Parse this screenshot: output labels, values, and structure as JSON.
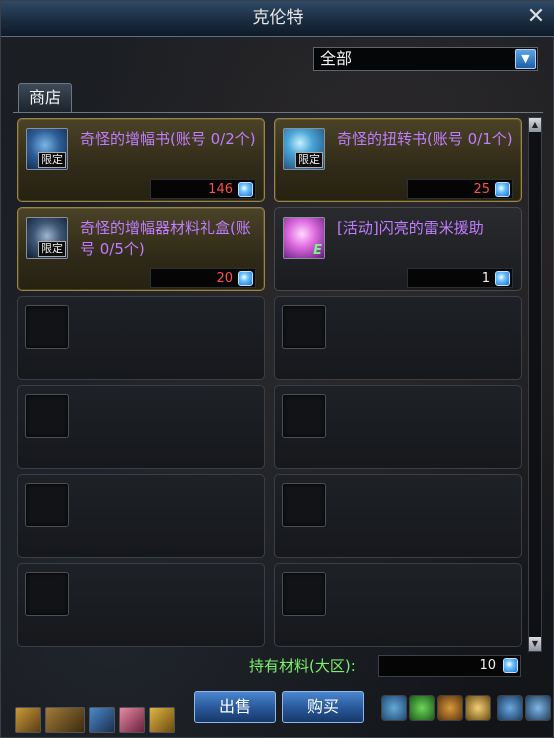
{
  "window": {
    "title": "克伦特"
  },
  "filter": {
    "selected": "全部"
  },
  "tabs": [
    {
      "label": "商店"
    }
  ],
  "items": [
    {
      "name": "奇怪的增幅书(账号 0/2个)",
      "badge": "限定",
      "icon": "book-icon",
      "price": "146",
      "price_color": "#ff4d4d"
    },
    {
      "name": "奇怪的扭转书(账号 0/1个)",
      "badge": "限定",
      "icon": "book-icon",
      "price": "25",
      "price_color": "#ff4d4d"
    },
    {
      "name": "奇怪的增幅器材料礼盒(账号 0/5个)",
      "badge": "限定",
      "icon": "hammer-icon",
      "price": "20",
      "price_color": "#ff4d4d"
    },
    {
      "name": "[活动]闪亮的雷米援助",
      "badge": "E",
      "icon": "gem-icon",
      "price": "1",
      "price_color": "#f2f2f2"
    }
  ],
  "materials": {
    "label": "持有材料(大区):",
    "value": "10"
  },
  "buttons": {
    "sell": "出售",
    "buy": "购买"
  },
  "colors": {
    "item_name": "#c07dff",
    "material_label": "#7cf26b",
    "accent": "#2a5a9c"
  }
}
